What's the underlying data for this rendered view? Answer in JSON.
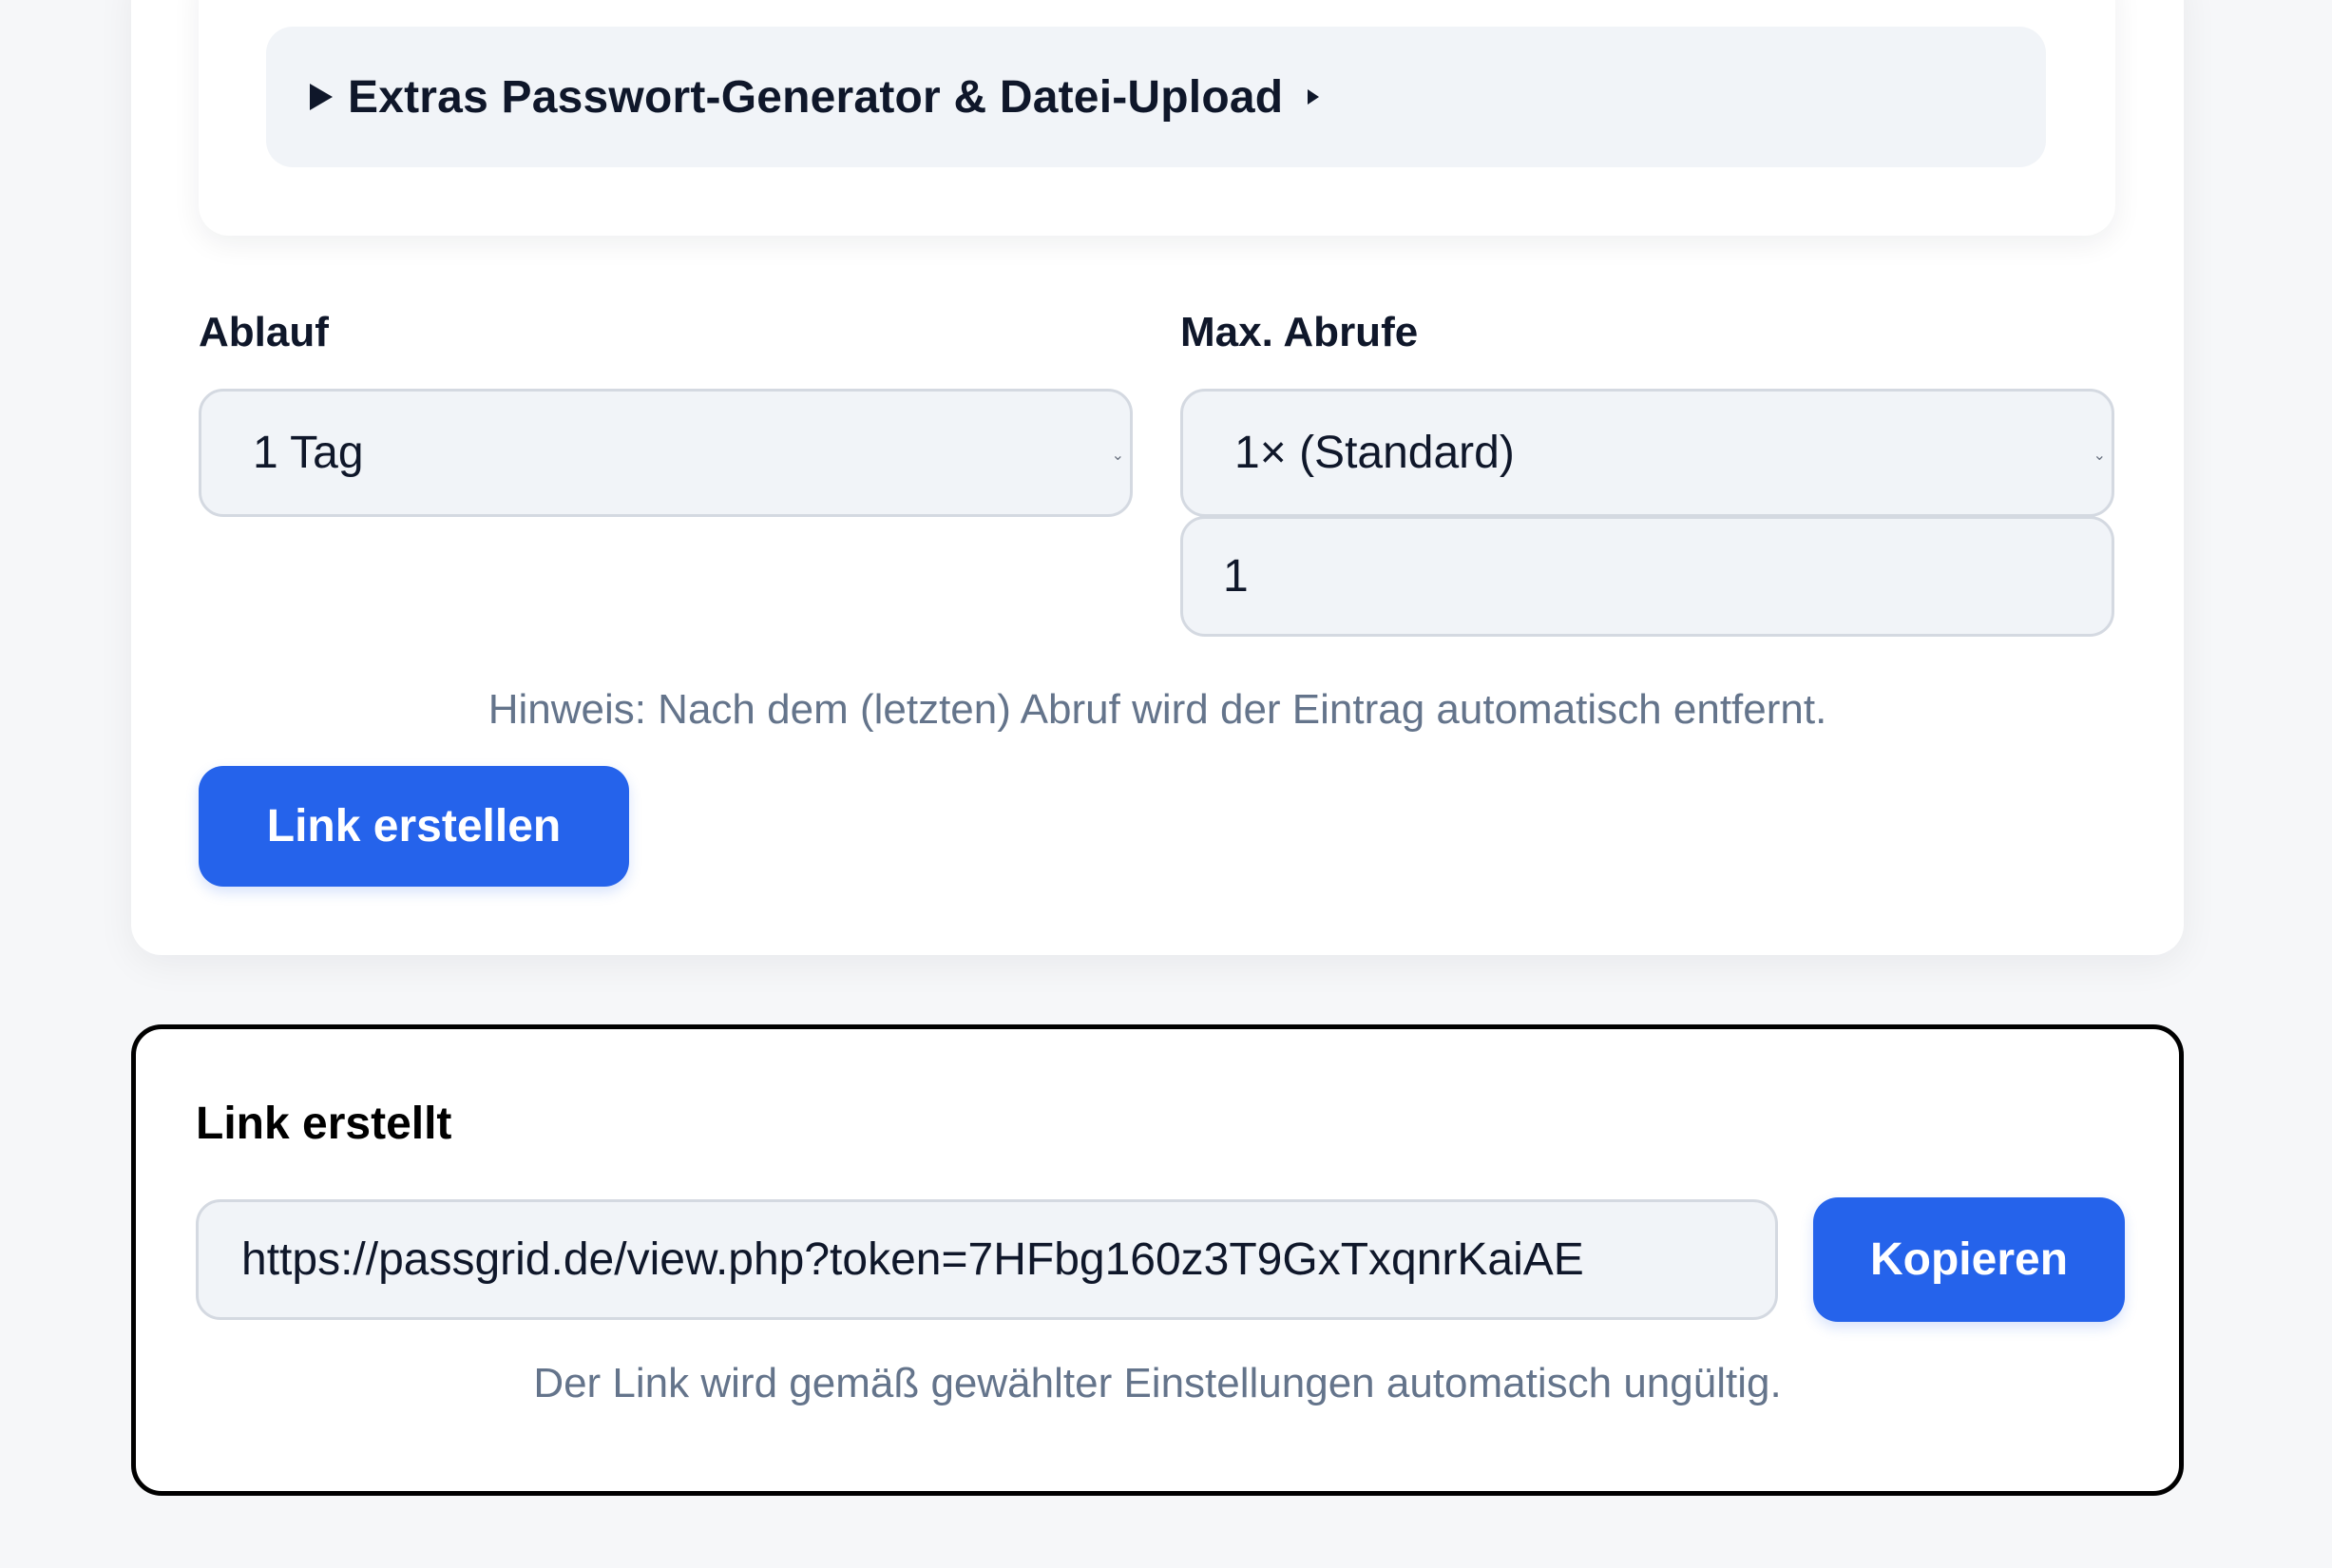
{
  "extras": {
    "summary_label": "Extras Passwort-Generator & Datei-Upload"
  },
  "settings": {
    "expiry_label": "Ablauf",
    "expiry_value": "1 Tag",
    "max_views_label": "Max. Abrufe",
    "max_views_value": "1× (Standard)",
    "max_views_custom": "1",
    "hint": "Hinweis: Nach dem (letzten) Abruf wird der Eintrag automatisch entfernt.",
    "create_button": "Link erstellen"
  },
  "result": {
    "title": "Link erstellt",
    "url": "https://passgrid.de/view.php?token=7HFbg160z3T9GxTxqnrKaiAE",
    "copy_button": "Kopieren",
    "note": "Der Link wird gemäß gewählter Einstellungen automatisch ungültig."
  },
  "colors": {
    "primary": "#2563eb",
    "field_bg": "#f1f4f8",
    "muted_text": "#64748b"
  }
}
